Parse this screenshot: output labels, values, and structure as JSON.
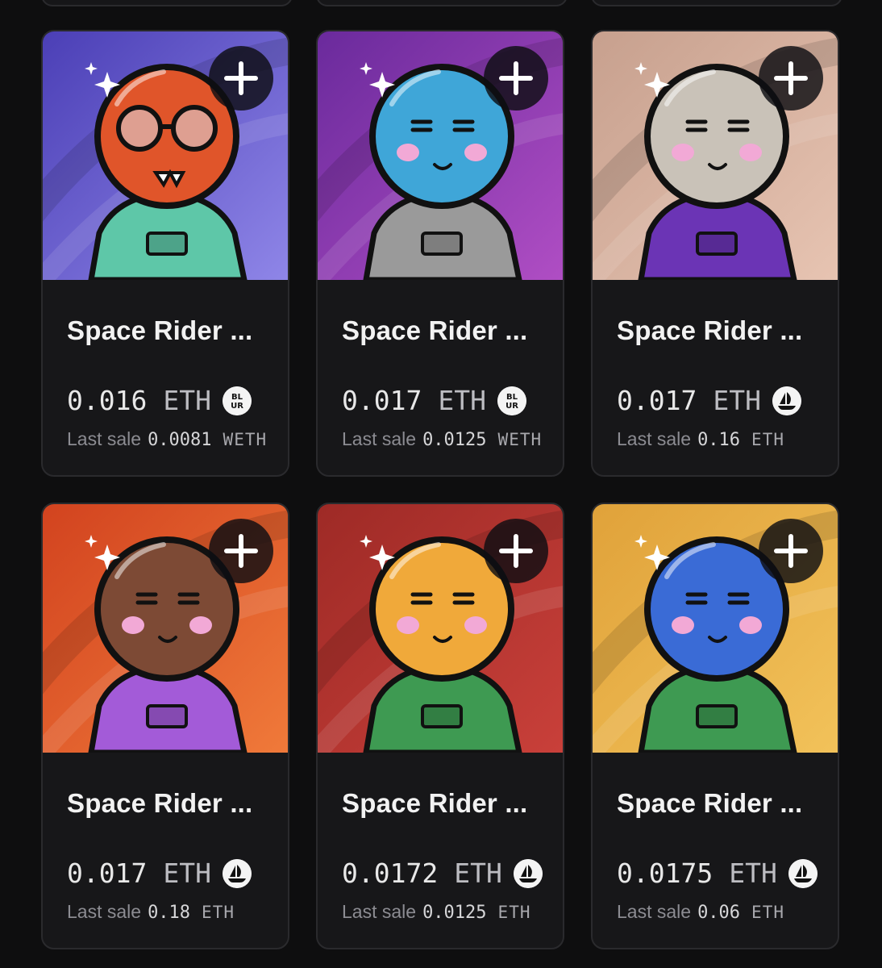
{
  "cards": [
    {
      "title": "Space Rider ...",
      "price": "0.016",
      "currency": "ETH",
      "marketplace_icon": "blur-icon",
      "last_sale_label": "Last sale",
      "last_sale_value": "0.0081",
      "last_sale_currency": "WETH",
      "bg_from": "#4b3fb6",
      "bg_to": "#8f86e8",
      "head": "#e0552a",
      "body": "#5ec7a8",
      "cheek": "none"
    },
    {
      "title": "Space Rider ...",
      "price": "0.017",
      "currency": "ETH",
      "marketplace_icon": "blur-icon",
      "last_sale_label": "Last sale",
      "last_sale_value": "0.0125",
      "last_sale_currency": "WETH",
      "bg_from": "#6a2a9c",
      "bg_to": "#b04ec4",
      "head": "#3fa6d8",
      "body": "#9a9a9a",
      "cheek": "#f2a9d6"
    },
    {
      "title": "Space Rider ...",
      "price": "0.017",
      "currency": "ETH",
      "marketplace_icon": "opensea-icon",
      "last_sale_label": "Last sale",
      "last_sale_value": "0.16",
      "last_sale_currency": "ETH",
      "bg_from": "#c7a08e",
      "bg_to": "#e7c4b2",
      "head": "#c9c2b8",
      "body": "#6b34b5",
      "cheek": "#f2a9d6"
    },
    {
      "title": "Space Rider ...",
      "price": "0.017",
      "currency": "ETH",
      "marketplace_icon": "opensea-icon",
      "last_sale_label": "Last sale",
      "last_sale_value": "0.18",
      "last_sale_currency": "ETH",
      "bg_from": "#d2431f",
      "bg_to": "#f07a3a",
      "head": "#7d4a35",
      "body": "#a35bd8",
      "cheek": "#f2a9d6"
    },
    {
      "title": "Space Rider ...",
      "price": "0.0172",
      "currency": "ETH",
      "marketplace_icon": "opensea-icon",
      "last_sale_label": "Last sale",
      "last_sale_value": "0.0125",
      "last_sale_currency": "ETH",
      "bg_from": "#9e2a26",
      "bg_to": "#c9403a",
      "head": "#f0a93a",
      "body": "#3e9a52",
      "cheek": "#f2a9d6"
    },
    {
      "title": "Space Rider ...",
      "price": "0.0175",
      "currency": "ETH",
      "marketplace_icon": "opensea-icon",
      "last_sale_label": "Last sale",
      "last_sale_value": "0.06",
      "last_sale_currency": "ETH",
      "bg_from": "#e0a23a",
      "bg_to": "#f2c25a",
      "head": "#3a6bd6",
      "body": "#3e9a52",
      "cheek": "#f2a9d6"
    }
  ]
}
